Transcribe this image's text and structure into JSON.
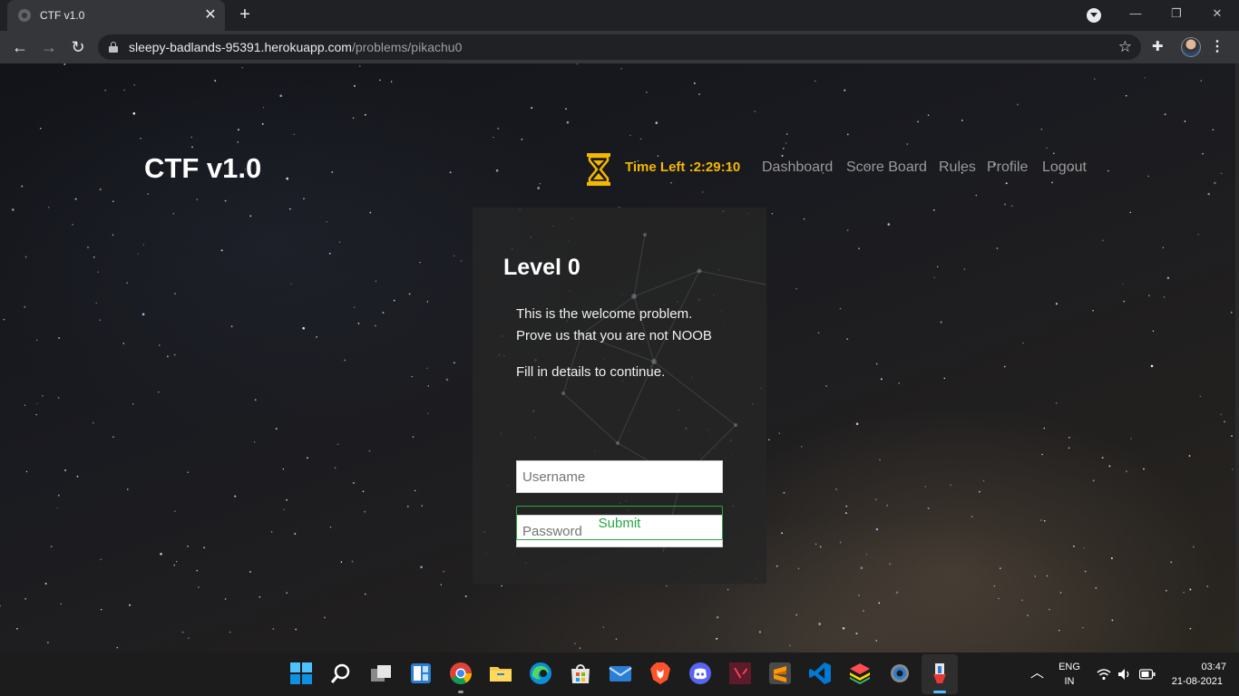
{
  "browser": {
    "tab_title": "CTF v1.0",
    "tab_close": "✕",
    "new_tab": "+",
    "url_host": "sleepy-badlands-95391.herokuapp.com",
    "url_path": "/problems/pikachu0",
    "window_buttons": {
      "minimize": "—",
      "restore": "❐",
      "close": "✕"
    }
  },
  "site": {
    "brand": "CTF v1.0",
    "timer": "Time Left :2:29:10",
    "timer_color": "#f5b800",
    "nav": [
      "Dashboard",
      "Score Board",
      "Rules",
      "Profile",
      "Logout"
    ]
  },
  "problem": {
    "title": "Level 0",
    "line1": "This is the welcome problem.",
    "line2": "Prove us that you are not NOOB",
    "line3": "Fill in details to continue.",
    "username_placeholder": "Username",
    "password_placeholder": "Password",
    "submit_label": "Submit",
    "accent_color": "#28a745"
  },
  "taskbar": {
    "icons": [
      "windows-start-icon",
      "search-icon",
      "task-view-icon",
      "widgets-icon",
      "chrome-icon",
      "file-explorer-icon",
      "edge-icon",
      "store-icon",
      "mail-icon",
      "brave-icon",
      "discord-icon",
      "valorant-icon",
      "sublime-text-icon",
      "vscode-icon",
      "bluestacks-icon",
      "settings-icon",
      "paint-icon"
    ],
    "language_top": "ENG",
    "language_bottom": "IN",
    "time": "03:47",
    "date": "21-08-2021"
  }
}
